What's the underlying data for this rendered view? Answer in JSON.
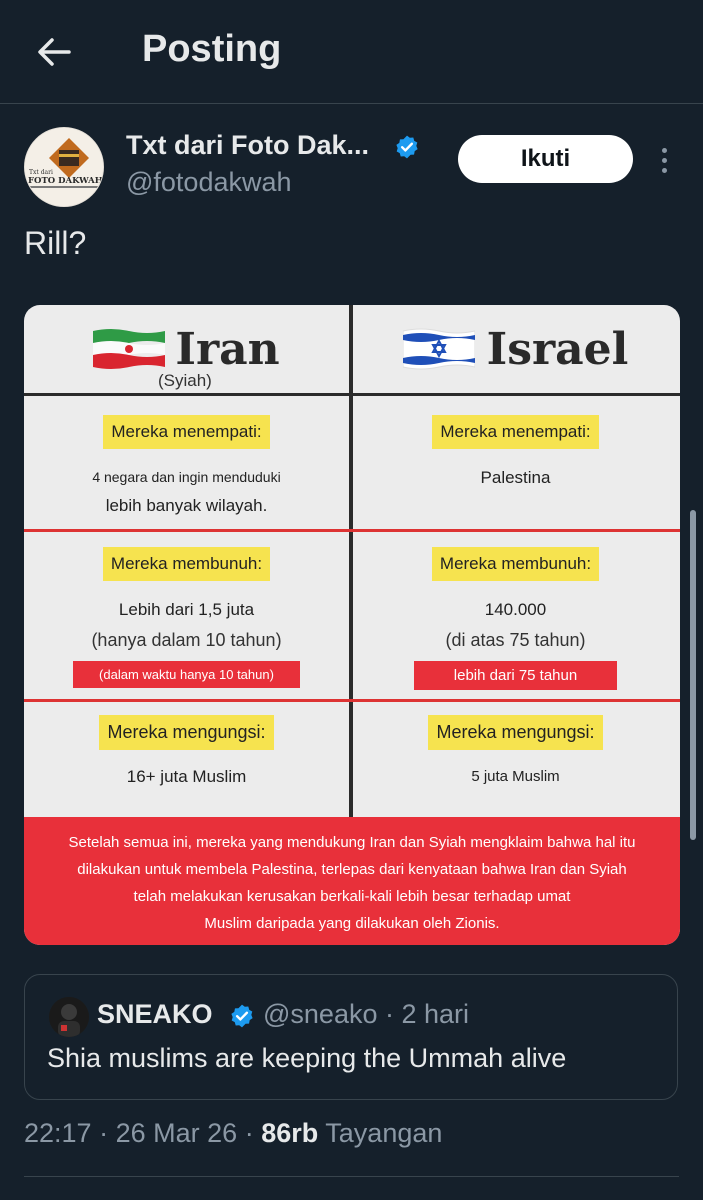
{
  "header": {
    "title": "Posting",
    "back_icon": "arrow-left-icon"
  },
  "author": {
    "name": "Txt dari Foto Dak...",
    "handle": "@fotodakwah",
    "verified": true,
    "avatar_text": "FOTO DAKWAH",
    "avatar_small_text": "Txt dari"
  },
  "follow_label": "Ikuti",
  "post_text": "Rill?",
  "infographic": {
    "left": {
      "country": "Iran",
      "sub": "(Syiah)"
    },
    "right": {
      "country": "Israel"
    },
    "rows": [
      {
        "left_tag": "Mereka menempati:",
        "left_lines": [
          "4 negara dan ingin menduduki",
          "lebih banyak wilayah."
        ],
        "right_tag": "Mereka menempati:",
        "right_lines": [
          "Palestina"
        ]
      },
      {
        "left_tag": "Mereka membunuh:",
        "left_lines": [
          "Lebih dari 1,5 juta",
          "(hanya dalam 10 tahun)"
        ],
        "left_bar": "(dalam waktu hanya 10 tahun)",
        "right_tag": "Mereka membunuh:",
        "right_lines": [
          "140.000",
          "(di atas 75 tahun)"
        ],
        "right_bar": "lebih dari 75 tahun"
      },
      {
        "left_tag": "Mereka mengungsi:",
        "left_lines": [
          "16+ juta Muslim"
        ],
        "right_tag": "Mereka mengungsi:",
        "right_lines": [
          "5 juta Muslim"
        ]
      }
    ],
    "banner_lines": [
      "Setelah semua ini, mereka yang mendukung Iran dan Syiah mengklaim bahwa hal itu",
      "dilakukan untuk membela Palestina, terlepas dari kenyataan bahwa Iran dan Syiah",
      "telah melakukan kerusakan berkali-kali lebih besar terhadap umat",
      "Muslim daripada yang dilakukan oleh Zionis."
    ]
  },
  "quote": {
    "name": "SNEAKO",
    "handle": "@sneako",
    "time": "· 2 hari",
    "text": "Shia muslims are keeping the Ummah alive"
  },
  "meta": {
    "time": "22:17",
    "sep1": "·",
    "date": "26 Mar 26",
    "sep2": "·",
    "views": "86rb",
    "views_label": "Tayangan"
  },
  "colors": {
    "background": "#15202b",
    "verified": "#1d9bf0",
    "banner": "#e8303a",
    "tag": "#f6e34f"
  }
}
